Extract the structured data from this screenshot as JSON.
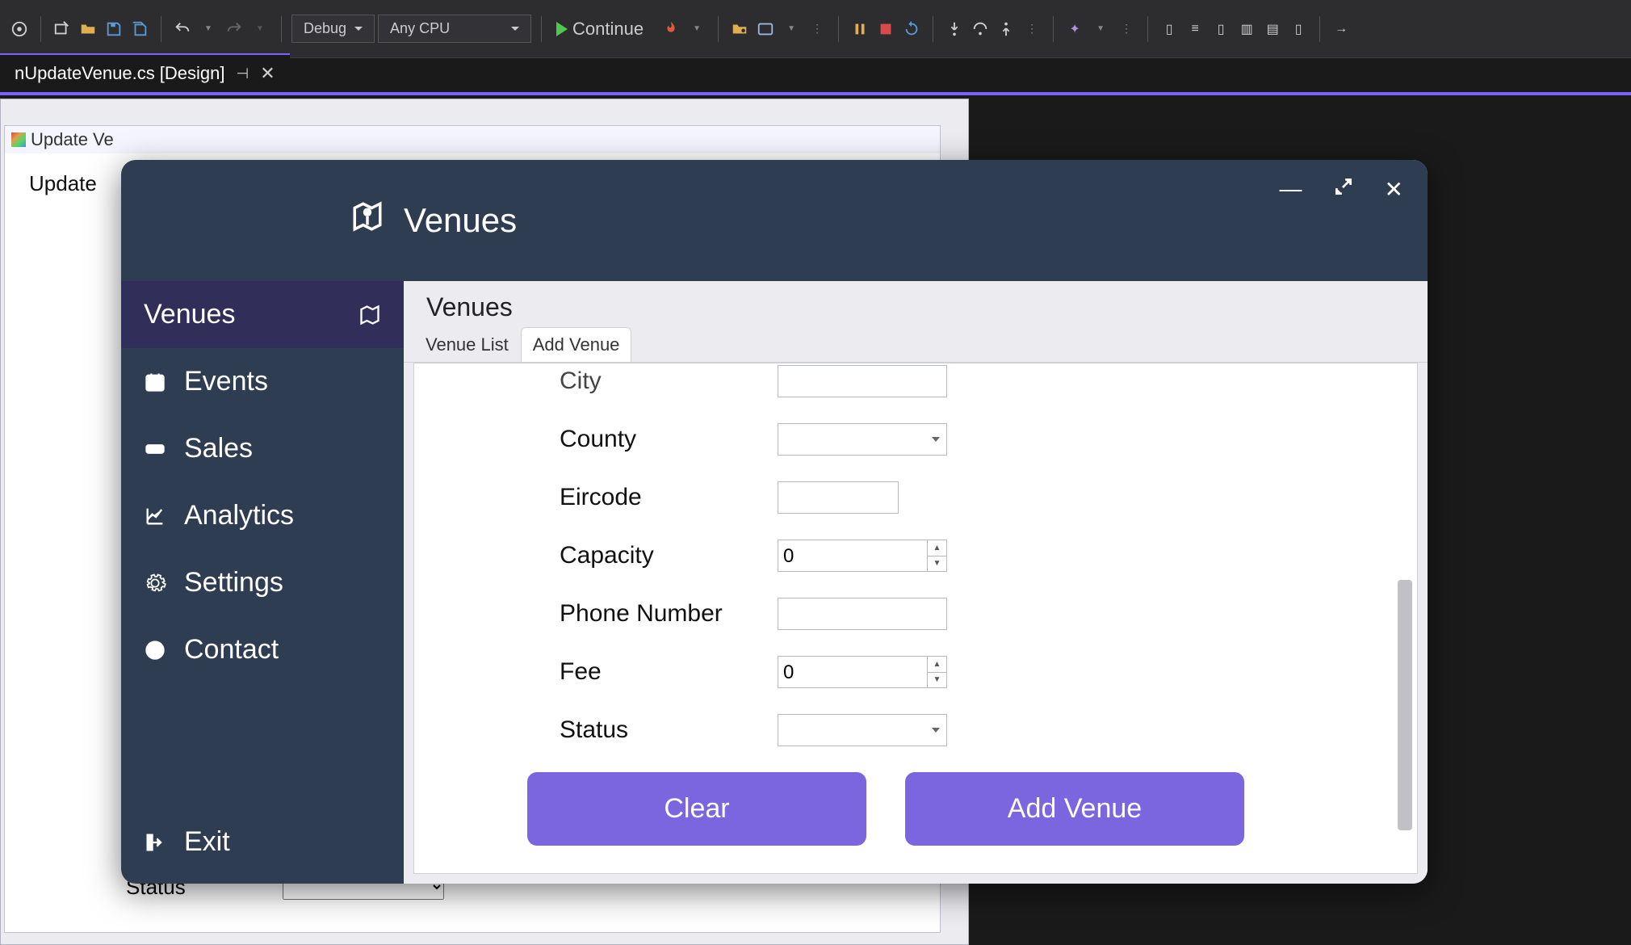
{
  "toolbar": {
    "config": "Debug",
    "platform": "Any CPU",
    "continue_label": "Continue"
  },
  "doc_tab": {
    "label": "nUpdateVenue.cs [Design]"
  },
  "designer": {
    "form_title": "Update Ve",
    "body_label": "Update",
    "status_label": "Status"
  },
  "app": {
    "header_title": "Venues",
    "controls": {
      "minimize": "—",
      "expand": "↗",
      "close": "✕"
    },
    "sidebar": {
      "items": [
        {
          "label": "Venues"
        },
        {
          "label": "Events"
        },
        {
          "label": "Sales"
        },
        {
          "label": "Analytics"
        },
        {
          "label": "Settings"
        },
        {
          "label": "Contact"
        }
      ],
      "exit_label": "Exit"
    },
    "main": {
      "title": "Venues",
      "tabs": [
        {
          "label": "Venue List"
        },
        {
          "label": "Add Venue"
        }
      ]
    },
    "form": {
      "city_label": "City",
      "city_value": "",
      "county_label": "County",
      "county_value": "",
      "eircode_label": "Eircode",
      "eircode_value": "",
      "capacity_label": "Capacity",
      "capacity_value": "0",
      "phone_label": "Phone Number",
      "phone_value": "",
      "fee_label": "Fee",
      "fee_value": "0",
      "status_label": "Status",
      "status_value": ""
    },
    "buttons": {
      "clear": "Clear",
      "add": "Add Venue"
    }
  }
}
